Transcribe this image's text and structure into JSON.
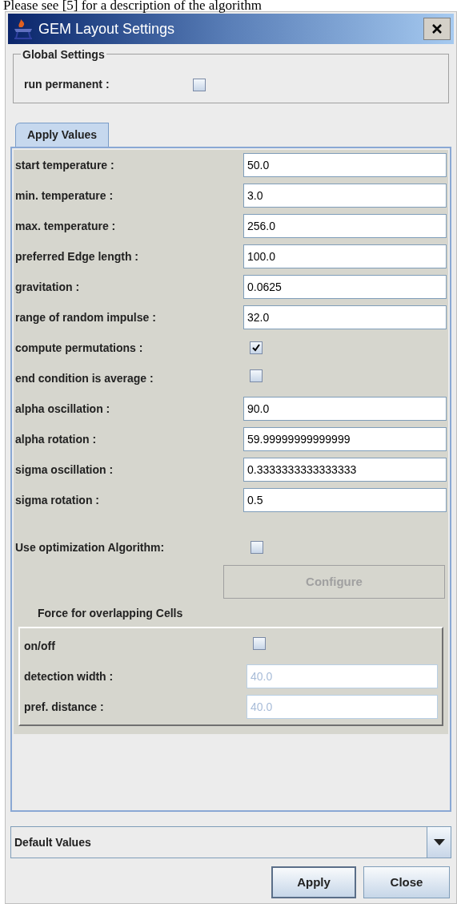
{
  "page_text": "Please see [5] for a description of the algorithm",
  "window": {
    "title": "GEM Layout Settings"
  },
  "global_settings": {
    "title": "Global Settings",
    "fields": [
      {
        "label": "run permanent :",
        "kind": "checkbox",
        "checked": false
      }
    ]
  },
  "tabs": [
    {
      "label": "Apply Values",
      "selected": true
    }
  ],
  "fields": [
    {
      "label": "start temperature :",
      "kind": "text",
      "value": "50.0"
    },
    {
      "label": "min. temperature :",
      "kind": "text",
      "value": "3.0"
    },
    {
      "label": "max. temperature :",
      "kind": "text",
      "value": "256.0"
    },
    {
      "label": "preferred Edge length :",
      "kind": "text",
      "value": "100.0"
    },
    {
      "label": "gravitation :",
      "kind": "text",
      "value": "0.0625"
    },
    {
      "label": "range of random impulse :",
      "kind": "text",
      "value": "32.0"
    },
    {
      "label": "compute permutations :",
      "kind": "checkbox",
      "checked": true
    },
    {
      "label": "end condition is average :",
      "kind": "checkbox",
      "checked": false
    },
    {
      "label": "alpha oscillation :",
      "kind": "text",
      "value": "90.0"
    },
    {
      "label": "alpha rotation :",
      "kind": "text",
      "value": "59.99999999999999"
    },
    {
      "label": "sigma oscillation :",
      "kind": "text",
      "value": "0.3333333333333333"
    },
    {
      "label": "sigma rotation :",
      "kind": "text",
      "value": "0.5"
    }
  ],
  "optimization": {
    "label": "Use optimization Algorithm:",
    "checked": false,
    "configure": {
      "label": "Configure",
      "disabled": true
    }
  },
  "overlap": {
    "title": "Force for overlapping Cells",
    "fields": [
      {
        "label": "on/off",
        "kind": "checkbox",
        "checked": false
      },
      {
        "label": "detection width :",
        "kind": "text",
        "value": "40.0",
        "disabled": true
      },
      {
        "label": "pref. distance :",
        "kind": "text",
        "value": "40.0",
        "disabled": true
      }
    ]
  },
  "preset": {
    "value": "Default Values"
  },
  "buttons": [
    {
      "label": "Apply",
      "default": true
    },
    {
      "label": "Close",
      "default": false
    }
  ]
}
